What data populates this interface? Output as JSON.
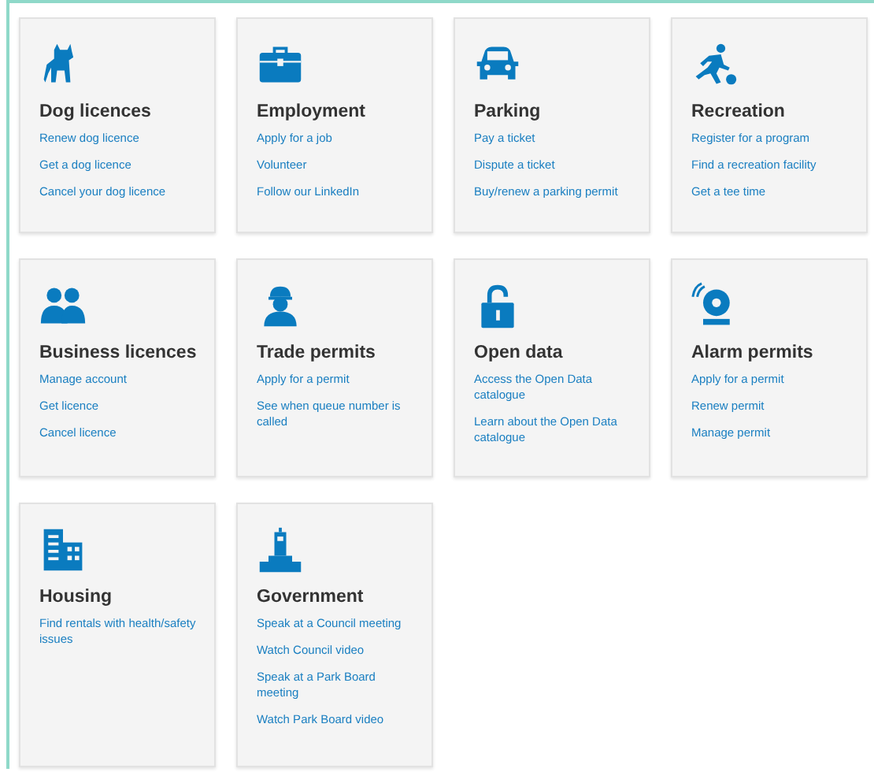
{
  "cards": [
    {
      "title": "Dog licences",
      "links": [
        "Renew dog licence",
        "Get a dog licence",
        "Cancel your dog licence"
      ]
    },
    {
      "title": "Employment",
      "links": [
        "Apply for a job",
        "Volunteer",
        "Follow our LinkedIn"
      ]
    },
    {
      "title": "Parking",
      "links": [
        "Pay a ticket",
        "Dispute a ticket",
        "Buy/renew a parking permit"
      ]
    },
    {
      "title": "Recreation",
      "links": [
        "Register for a program",
        "Find a recreation facility",
        "Get a tee time"
      ]
    },
    {
      "title": "Business licences",
      "links": [
        "Manage account",
        "Get licence",
        "Cancel licence"
      ]
    },
    {
      "title": "Trade permits",
      "links": [
        "Apply for a permit",
        "See when queue number is called"
      ]
    },
    {
      "title": "Open data",
      "links": [
        "Access the Open Data catalogue",
        "Learn about the Open Data catalogue"
      ]
    },
    {
      "title": "Alarm permits",
      "links": [
        "Apply for a permit",
        "Renew permit",
        "Manage permit"
      ]
    },
    {
      "title": "Housing",
      "links": [
        "Find rentals with health/safety issues"
      ]
    },
    {
      "title": "Government",
      "links": [
        "Speak at a Council meeting",
        "Watch Council video",
        "Speak at a Park Board meeting",
        "Watch Park Board video"
      ]
    }
  ]
}
